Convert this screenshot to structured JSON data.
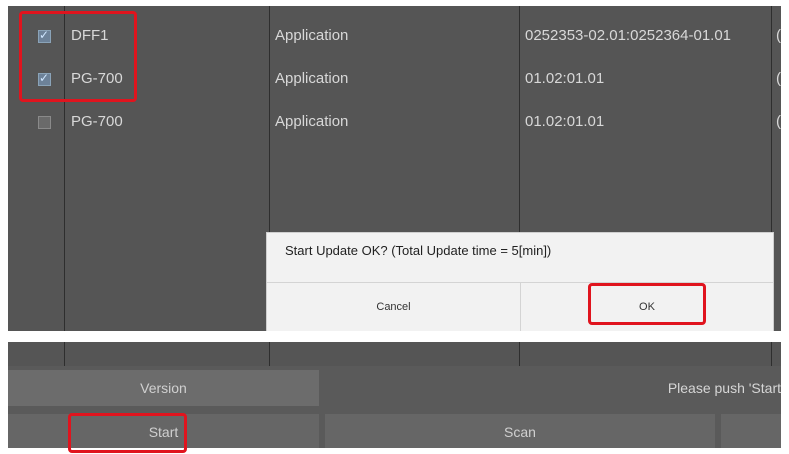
{
  "table": {
    "rows": [
      {
        "checked": true,
        "name": "DFF1",
        "type": "Application",
        "version": "0252353-02.01:0252364-01.01",
        "extra": "("
      },
      {
        "checked": true,
        "name": "PG-700",
        "type": "Application",
        "version": "01.02:01.01",
        "extra": "("
      },
      {
        "checked": false,
        "name": "PG-700",
        "type": "Application",
        "version": "01.02:01.01",
        "extra": "("
      }
    ]
  },
  "dialog": {
    "message": "Start Update OK?    (Total Update time = 5[min])",
    "cancel_label": "Cancel",
    "ok_label": "OK"
  },
  "footer": {
    "version_label": "Version",
    "status_text": "Please push 'Start",
    "start_label": "Start",
    "scan_label": "Scan"
  },
  "colors": {
    "highlight": "#e0141e",
    "panel": "#555555"
  }
}
